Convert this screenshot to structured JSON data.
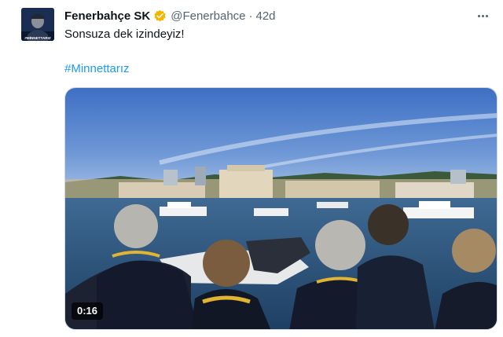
{
  "tweet": {
    "display_name": "Fenerbahçe SK",
    "handle": "@Fenerbahce",
    "separator": "·",
    "time": "42d",
    "text": "Sonsuza dek izindeyiz!",
    "hashtag": "#Minnettarız",
    "avatar_caption": "#MİNNETTARIZ",
    "verified_color": "#f4b400",
    "link_color": "#1d9bf0"
  },
  "video": {
    "duration": "0:16"
  },
  "icons": {
    "verified": "verified-badge-icon",
    "more": "more-options-icon"
  }
}
